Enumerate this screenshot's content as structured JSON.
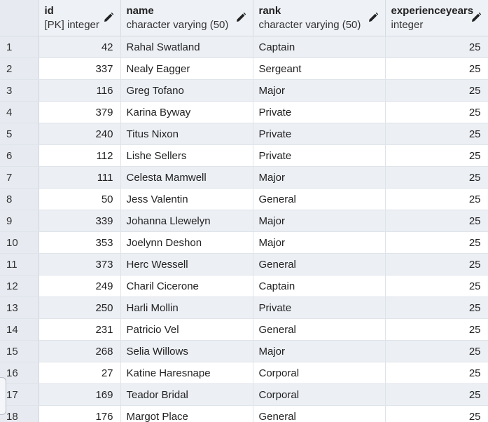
{
  "columns": [
    {
      "key": "id",
      "title": "id",
      "type": "[PK] integer"
    },
    {
      "key": "name",
      "title": "name",
      "type": "character varying (50)"
    },
    {
      "key": "rank",
      "title": "rank",
      "type": "character varying (50)"
    },
    {
      "key": "experienceyears",
      "title": "experienceyears",
      "type": "integer"
    }
  ],
  "icons": {
    "edit_column": "pencil-icon"
  },
  "colors": {
    "header_bg": "#eef1f6",
    "row_alt_bg": "#eceff4",
    "rownum_bg": "#e7ebf1"
  },
  "rows": [
    {
      "n": "1",
      "id": "42",
      "name": "Rahal Swatland",
      "rank": "Captain",
      "experienceyears": "25"
    },
    {
      "n": "2",
      "id": "337",
      "name": "Nealy Eagger",
      "rank": "Sergeant",
      "experienceyears": "25"
    },
    {
      "n": "3",
      "id": "116",
      "name": "Greg Tofano",
      "rank": "Major",
      "experienceyears": "25"
    },
    {
      "n": "4",
      "id": "379",
      "name": "Karina Byway",
      "rank": "Private",
      "experienceyears": "25"
    },
    {
      "n": "5",
      "id": "240",
      "name": "Titus Nixon",
      "rank": "Private",
      "experienceyears": "25"
    },
    {
      "n": "6",
      "id": "112",
      "name": "Lishe Sellers",
      "rank": "Private",
      "experienceyears": "25"
    },
    {
      "n": "7",
      "id": "111",
      "name": "Celesta Mamwell",
      "rank": "Major",
      "experienceyears": "25"
    },
    {
      "n": "8",
      "id": "50",
      "name": "Jess Valentin",
      "rank": "General",
      "experienceyears": "25"
    },
    {
      "n": "9",
      "id": "339",
      "name": "Johanna Llewelyn",
      "rank": "Major",
      "experienceyears": "25"
    },
    {
      "n": "10",
      "id": "353",
      "name": "Joelynn Deshon",
      "rank": "Major",
      "experienceyears": "25"
    },
    {
      "n": "11",
      "id": "373",
      "name": "Herc Wessell",
      "rank": "General",
      "experienceyears": "25"
    },
    {
      "n": "12",
      "id": "249",
      "name": "Charil Cicerone",
      "rank": "Captain",
      "experienceyears": "25"
    },
    {
      "n": "13",
      "id": "250",
      "name": "Harli Mollin",
      "rank": "Private",
      "experienceyears": "25"
    },
    {
      "n": "14",
      "id": "231",
      "name": "Patricio Vel",
      "rank": "General",
      "experienceyears": "25"
    },
    {
      "n": "15",
      "id": "268",
      "name": "Selia Willows",
      "rank": "Major",
      "experienceyears": "25"
    },
    {
      "n": "16",
      "id": "27",
      "name": "Katine Haresnape",
      "rank": "Corporal",
      "experienceyears": "25"
    },
    {
      "n": "17",
      "id": "169",
      "name": "Teador Bridal",
      "rank": "Corporal",
      "experienceyears": "25"
    },
    {
      "n": "18",
      "id": "176",
      "name": "Margot Place",
      "rank": "General",
      "experienceyears": "25"
    }
  ]
}
